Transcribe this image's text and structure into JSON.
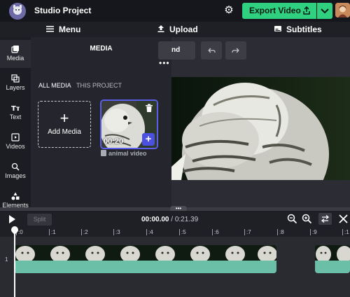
{
  "header": {
    "project_title": "Studio Project",
    "export_label": "Export Video"
  },
  "menubar": {
    "menu_label": "Menu",
    "upload_label": "Upload",
    "subtitles_label": "Subtitles"
  },
  "rail": {
    "items": [
      {
        "label": "Media",
        "icon": "media-icon"
      },
      {
        "label": "Layers",
        "icon": "layers-icon"
      },
      {
        "label": "Text",
        "icon": "text-icon"
      },
      {
        "label": "Videos",
        "icon": "videos-icon"
      },
      {
        "label": "Images",
        "icon": "images-icon"
      },
      {
        "label": "Elements",
        "icon": "elements-icon"
      }
    ]
  },
  "panel": {
    "title": "MEDIA",
    "tabs": [
      "ALL MEDIA",
      "THIS PROJECT"
    ],
    "add_media_label": "Add Media",
    "item": {
      "duration": "00:20",
      "name": "animal video"
    }
  },
  "stage": {
    "toolbar_partial_label": "nd"
  },
  "timeline": {
    "split_label": "Split",
    "current_time": "00:00.00",
    "total_time": " / 0:21.39",
    "ticks": [
      ":0",
      ":1",
      ":2",
      ":3",
      ":4",
      ":5",
      ":6",
      ":7",
      ":8",
      ":9",
      ":1"
    ],
    "track_number": "1"
  },
  "colors": {
    "accent_green": "#2fd07f",
    "accent_blue": "#5b5ee8",
    "clip_teal": "#6bbfa6"
  }
}
